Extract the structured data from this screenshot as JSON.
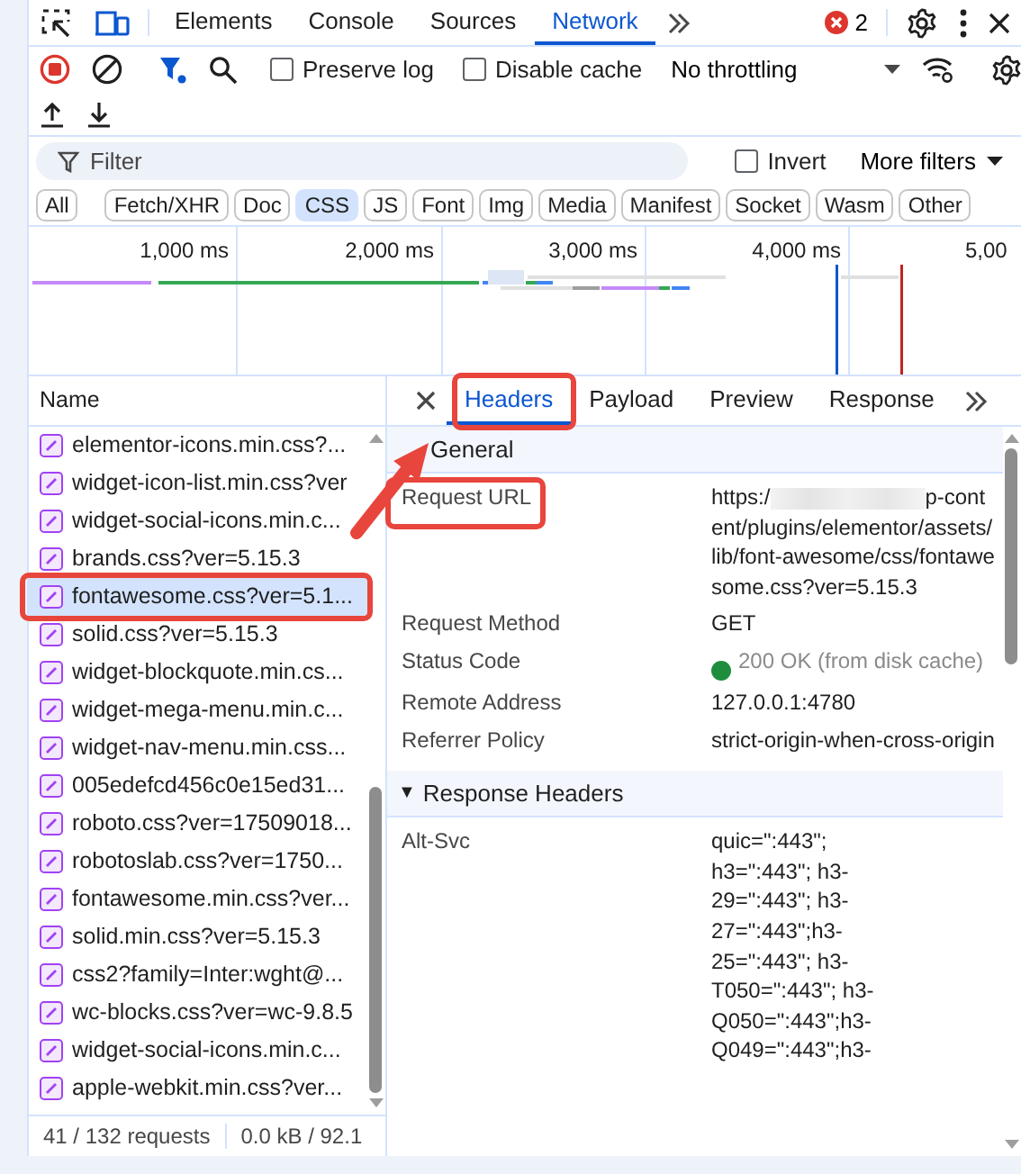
{
  "main_tabs": [
    {
      "label": "Elements",
      "selected": false
    },
    {
      "label": "Console",
      "selected": false
    },
    {
      "label": "Sources",
      "selected": false
    },
    {
      "label": "Network",
      "selected": true
    }
  ],
  "error_count": "2",
  "toolbar": {
    "preserve_log": {
      "label": "Preserve log",
      "checked": false
    },
    "disable_cache": {
      "label": "Disable cache",
      "checked": false
    },
    "throttling": "No throttling"
  },
  "filter": {
    "placeholder": "Filter",
    "invert": {
      "label": "Invert",
      "checked": false
    },
    "more_filters": "More filters"
  },
  "type_filters": [
    {
      "label": "All",
      "selected": false
    },
    {
      "label": "Fetch/XHR",
      "selected": false
    },
    {
      "label": "Doc",
      "selected": false
    },
    {
      "label": "CSS",
      "selected": true
    },
    {
      "label": "JS",
      "selected": false
    },
    {
      "label": "Font",
      "selected": false
    },
    {
      "label": "Img",
      "selected": false
    },
    {
      "label": "Media",
      "selected": false
    },
    {
      "label": "Manifest",
      "selected": false
    },
    {
      "label": "Socket",
      "selected": false
    },
    {
      "label": "Wasm",
      "selected": false
    },
    {
      "label": "Other",
      "selected": false
    }
  ],
  "timeline": {
    "ticks": [
      "1,000 ms",
      "2,000 ms",
      "3,000 ms",
      "4,000 ms",
      "5,00"
    ]
  },
  "requests": {
    "column": "Name",
    "rows": [
      {
        "name": "elementor-icons.min.css?...",
        "selected": false
      },
      {
        "name": "widget-icon-list.min.css?ver",
        "selected": false
      },
      {
        "name": "widget-social-icons.min.c...",
        "selected": false
      },
      {
        "name": "brands.css?ver=5.15.3",
        "selected": false
      },
      {
        "name": "fontawesome.css?ver=5.1...",
        "selected": true
      },
      {
        "name": "solid.css?ver=5.15.3",
        "selected": false
      },
      {
        "name": "widget-blockquote.min.cs...",
        "selected": false
      },
      {
        "name": "widget-mega-menu.min.c...",
        "selected": false
      },
      {
        "name": "widget-nav-menu.min.css...",
        "selected": false
      },
      {
        "name": "005edefcd456c0e15ed31...",
        "selected": false
      },
      {
        "name": "roboto.css?ver=17509018...",
        "selected": false
      },
      {
        "name": "robotoslab.css?ver=1750...",
        "selected": false
      },
      {
        "name": "fontawesome.min.css?ver...",
        "selected": false
      },
      {
        "name": "solid.min.css?ver=5.15.3",
        "selected": false
      },
      {
        "name": "css2?family=Inter:wght@...",
        "selected": false
      },
      {
        "name": "wc-blocks.css?ver=wc-9.8.5",
        "selected": false
      },
      {
        "name": "widget-social-icons.min.c...",
        "selected": false
      },
      {
        "name": "apple-webkit.min.css?ver...",
        "selected": false
      }
    ],
    "footer": [
      "41 / 132 requests",
      "0.0 kB / 92.1"
    ]
  },
  "detail": {
    "tabs": [
      {
        "label": "Headers",
        "selected": true
      },
      {
        "label": "Payload",
        "selected": false
      },
      {
        "label": "Preview",
        "selected": false
      },
      {
        "label": "Response",
        "selected": false
      }
    ],
    "sections": [
      {
        "title": "General",
        "rows": [
          {
            "kind": "redacted",
            "key": "Request URL",
            "value": "https:/",
            "value_rest": "p-content/plugins/elementor/assets/lib/font-awesome/css/fontawesome.css?ver=5.15.3"
          },
          {
            "kind": "text",
            "key": "Request Method",
            "value": "GET"
          },
          {
            "kind": "status",
            "key": "Status Code",
            "value": "200 OK (from disk cache)",
            "color": "#1e8e3e"
          },
          {
            "kind": "text",
            "key": "Remote Address",
            "value": "127.0.0.1:4780"
          },
          {
            "kind": "text",
            "key": "Referrer Policy",
            "value": "strict-origin-when-cross-origin"
          }
        ]
      },
      {
        "title": "Response Headers",
        "toggle": "▼",
        "rows": [
          {
            "kind": "lines",
            "key": "Alt-Svc",
            "lines": [
              "quic=\":443\";",
              "h3=\":443\"; h3-",
              "29=\":443\"; h3-",
              "27=\":443\";h3-",
              "25=\":443\"; h3-",
              "T050=\":443\"; h3-",
              "Q050=\":443\";h3-",
              "Q049=\":443\";h3-"
            ]
          }
        ]
      }
    ]
  }
}
